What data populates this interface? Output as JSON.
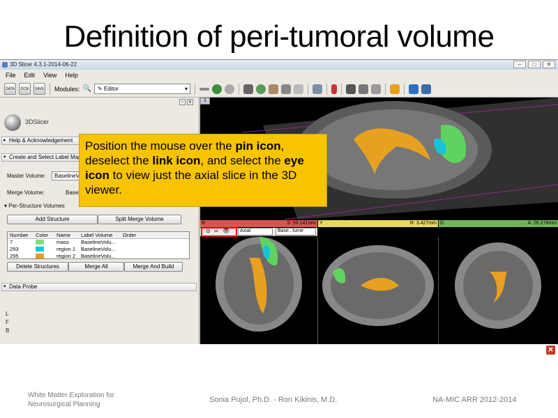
{
  "slide": {
    "title": "Definition of peri-tumoral volume",
    "callout": {
      "parts": [
        {
          "text": "Position the mouse over the ",
          "bold": false
        },
        {
          "text": "pin icon",
          "bold": true
        },
        {
          "text": ", deselect the ",
          "bold": false
        },
        {
          "text": "link icon",
          "bold": true
        },
        {
          "text": ", and select the ",
          "bold": false
        },
        {
          "text": "eye icon",
          "bold": true
        },
        {
          "text": " to view just the axial slice in the 3D viewer.",
          "bold": false
        }
      ]
    },
    "footer": {
      "left_line1": "White Matter Exploration for",
      "left_line2": "Neurosurgical Planning",
      "center": "Sonia Pujol, Ph.D. - Ron Kikinis, M.D.",
      "right": "NA-MIC ARR 2012-2014"
    }
  },
  "window": {
    "title": "3D Slicer 4.3.1-2014-06-22",
    "menu": [
      "File",
      "Edit",
      "View",
      "Help"
    ],
    "toolbar": {
      "btn_data": "DATA",
      "btn_dcm": "DCM",
      "btn_save": "SAVE",
      "modules_label": "Modules:",
      "module_value": "Editor"
    }
  },
  "left_panel": {
    "logo_text": "3DSlicer",
    "sections": {
      "help": "Help & Acknowledgement",
      "create": "Create and Select Label Map",
      "data_probe": "Data Probe",
      "per_structure": "Per-Structure Volumes"
    },
    "master_volume_label": "Master Volume:",
    "master_volume_value": "BaselineVolume",
    "merge_volume_label": "Merge Volume:",
    "merge_volume_value": "BaselineVolume-label",
    "buttons": {
      "add_structure": "Add Structure",
      "split_merge": "Split Merge Volume",
      "delete_structures": "Delete Structures",
      "merge_all": "Merge All",
      "merge_build": "Merge And Build"
    },
    "table": {
      "headers": [
        "Number",
        "Color",
        "Name",
        "Label Volume",
        "Order"
      ],
      "rows": [
        {
          "number": "7",
          "color": "#7fe07f",
          "name": "mass",
          "label_volume": "BaselineVolu..."
        },
        {
          "number": "293",
          "color": "#17c9d9",
          "name": "region 1",
          "label_volume": "BaselineVolu..."
        },
        {
          "number": "295",
          "color": "#e0a020",
          "name": "region 2",
          "label_volume": "BaselineVolu..."
        }
      ]
    },
    "coords": [
      "L",
      "F",
      "B"
    ]
  },
  "viewers": {
    "view3d_label": "1",
    "red": {
      "letter": "R",
      "offset": "S: 59.141mm",
      "color": "#d8564f",
      "orientation": "Axial",
      "volume": "Base...lume"
    },
    "yellow": {
      "letter": "Y",
      "offset": "R: 3.427mm",
      "color": "#e6da5a"
    },
    "green": {
      "letter": "G",
      "offset": "A: 26.278mm",
      "color": "#72b35a"
    }
  },
  "colors": {
    "callout_bg": "#f8c400",
    "tract_orange": "#e8a020",
    "tumor_green": "#5fd35f",
    "tumor_cyan": "#19c3d6"
  }
}
